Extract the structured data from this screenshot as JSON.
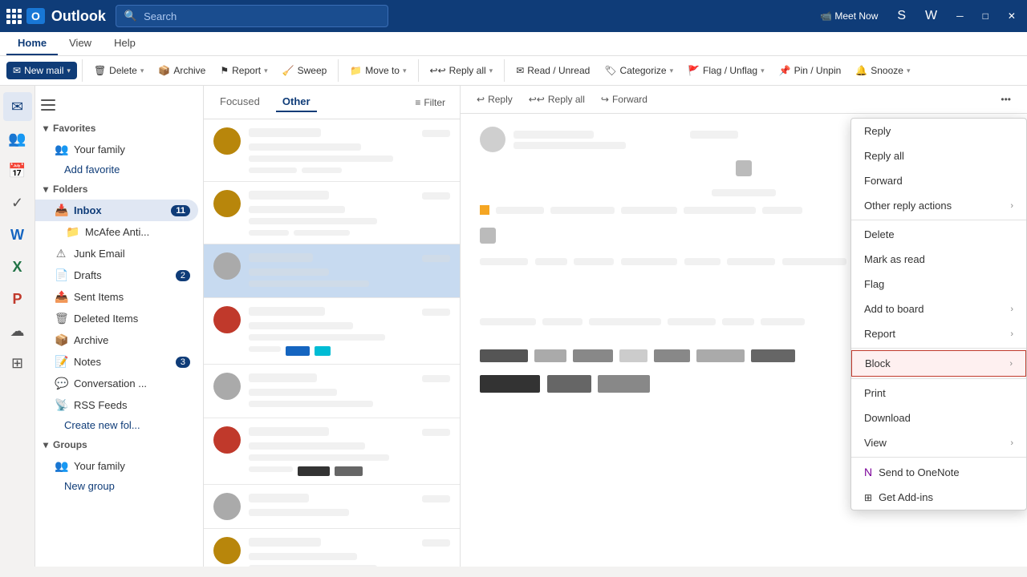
{
  "titleBar": {
    "appName": "Outlook",
    "searchPlaceholder": "Search",
    "buttons": [
      "Meet Now",
      "S",
      "W"
    ]
  },
  "ribbon": {
    "tabs": [
      "Home",
      "View",
      "Help"
    ],
    "activeTab": "Home",
    "actions": [
      {
        "label": "New mail",
        "primary": true,
        "hasDropdown": true,
        "icon": "✉"
      },
      {
        "label": "Delete",
        "hasDropdown": true,
        "icon": "🗑"
      },
      {
        "label": "Archive",
        "hasDropdown": false,
        "icon": "📦"
      },
      {
        "label": "Report",
        "hasDropdown": true,
        "icon": "⚠"
      },
      {
        "label": "Sweep",
        "hasDropdown": false,
        "icon": "🧹"
      },
      {
        "label": "Move to",
        "hasDropdown": true,
        "icon": "📁"
      },
      {
        "label": "Reply all",
        "hasDropdown": true,
        "icon": "↩"
      },
      {
        "label": "Read / Unread",
        "hasDropdown": false,
        "icon": "✉"
      },
      {
        "label": "Categorize",
        "hasDropdown": true,
        "icon": "🏷"
      },
      {
        "label": "Flag / Unflag",
        "hasDropdown": true,
        "icon": "🚩"
      },
      {
        "label": "Pin / Unpin",
        "hasDropdown": false,
        "icon": "📌"
      },
      {
        "label": "Snooze",
        "hasDropdown": true,
        "icon": "🔔"
      }
    ]
  },
  "iconSidebar": {
    "items": [
      {
        "icon": "✉",
        "name": "mail",
        "active": true
      },
      {
        "icon": "👥",
        "name": "people"
      },
      {
        "icon": "📅",
        "name": "calendar"
      },
      {
        "icon": "✓",
        "name": "tasks"
      },
      {
        "icon": "W",
        "name": "word"
      },
      {
        "icon": "X",
        "name": "excel"
      },
      {
        "icon": "P",
        "name": "powerpoint"
      },
      {
        "icon": "☁",
        "name": "onedrive"
      },
      {
        "icon": "⊞",
        "name": "apps"
      }
    ]
  },
  "navSidebar": {
    "favorites": {
      "header": "Favorites",
      "items": [
        {
          "label": "Your family",
          "icon": "👥"
        },
        {
          "addLabel": "Add favorite"
        }
      ]
    },
    "folders": {
      "header": "Folders",
      "items": [
        {
          "label": "Inbox",
          "icon": "📥",
          "badge": "11",
          "active": true,
          "subitems": [
            {
              "label": "McAfee Anti..."
            }
          ]
        },
        {
          "label": "Junk Email",
          "icon": "⚠"
        },
        {
          "label": "Drafts",
          "icon": "📄",
          "badge": "2"
        },
        {
          "label": "Sent Items",
          "icon": "📤"
        },
        {
          "label": "Deleted Items",
          "icon": "🗑"
        },
        {
          "label": "Archive",
          "icon": "📦"
        },
        {
          "label": "Notes",
          "icon": "📝",
          "badge": "3"
        },
        {
          "label": "Conversation ...",
          "icon": "💬"
        },
        {
          "label": "RSS Feeds",
          "icon": "📡"
        },
        {
          "addLabel": "Create new fol..."
        }
      ]
    },
    "groups": {
      "header": "Groups",
      "items": [
        {
          "label": "Your family",
          "icon": "👥"
        },
        {
          "addLabel": "New group"
        }
      ]
    }
  },
  "mailList": {
    "tabs": [
      "Focused",
      "Other"
    ],
    "activeTab": "Other",
    "filterLabel": "Filter",
    "items": [
      {
        "id": 1,
        "avatarColor": "#b8860b",
        "sender": "████ ████",
        "time": "████",
        "subject": "███████ ████",
        "preview": "██████ ████████",
        "selected": false
      },
      {
        "id": 2,
        "avatarColor": "#b8860b",
        "sender": "████ ████",
        "time": "████",
        "subject": "███████ ████",
        "preview": "██████ ████████",
        "selected": false
      },
      {
        "id": 3,
        "avatarColor": "#aaa",
        "sender": "████ ████",
        "time": "████",
        "subject": "███████ ████",
        "preview": "██████ ████████",
        "selected": true
      },
      {
        "id": 4,
        "avatarColor": "#c0392b",
        "sender": "████ ████",
        "time": "████",
        "subject": "███████ ████",
        "preview": "██████ ████████",
        "selected": false
      },
      {
        "id": 5,
        "avatarColor": "#aaa",
        "sender": "████ ████",
        "time": "████",
        "subject": "███████ ████",
        "preview": "██████ ████████",
        "selected": false
      },
      {
        "id": 6,
        "avatarColor": "#c0392b",
        "sender": "████ ████",
        "time": "████",
        "subject": "███████ ████",
        "preview": "██████ ████████",
        "selected": false
      },
      {
        "id": 7,
        "avatarColor": "#aaa",
        "sender": "████ ████",
        "time": "████",
        "subject": "███████ ████",
        "preview": "██████ ████████",
        "selected": false
      },
      {
        "id": 8,
        "avatarColor": "#b8860b",
        "sender": "████ ████",
        "time": "████",
        "subject": "███████ ████",
        "preview": "██████ ████████",
        "selected": false
      }
    ]
  },
  "contentToolbar": {
    "buttons": [
      "Reply",
      "Reply all",
      "Forward",
      "..."
    ]
  },
  "contextMenu": {
    "items": [
      {
        "label": "Reply",
        "hasSubmenu": false
      },
      {
        "label": "Reply all",
        "hasSubmenu": false
      },
      {
        "label": "Forward",
        "hasSubmenu": false
      },
      {
        "label": "Other reply actions",
        "hasSubmenu": true
      },
      {
        "separator": true
      },
      {
        "label": "Delete",
        "hasSubmenu": false
      },
      {
        "label": "Mark as read",
        "hasSubmenu": false
      },
      {
        "label": "Flag",
        "hasSubmenu": false
      },
      {
        "label": "Add to board",
        "hasSubmenu": true
      },
      {
        "label": "Report",
        "hasSubmenu": true
      },
      {
        "separator": true
      },
      {
        "label": "Block",
        "hasSubmenu": true,
        "highlighted": true
      },
      {
        "separator": true
      },
      {
        "label": "Print",
        "hasSubmenu": false
      },
      {
        "label": "Download",
        "hasSubmenu": false
      },
      {
        "label": "View",
        "hasSubmenu": true
      },
      {
        "separator": true
      },
      {
        "label": "Send to OneNote",
        "hasSubmenu": false,
        "icon": "🔴"
      },
      {
        "label": "Get Add-ins",
        "hasSubmenu": false,
        "icon": "⊞"
      }
    ]
  }
}
